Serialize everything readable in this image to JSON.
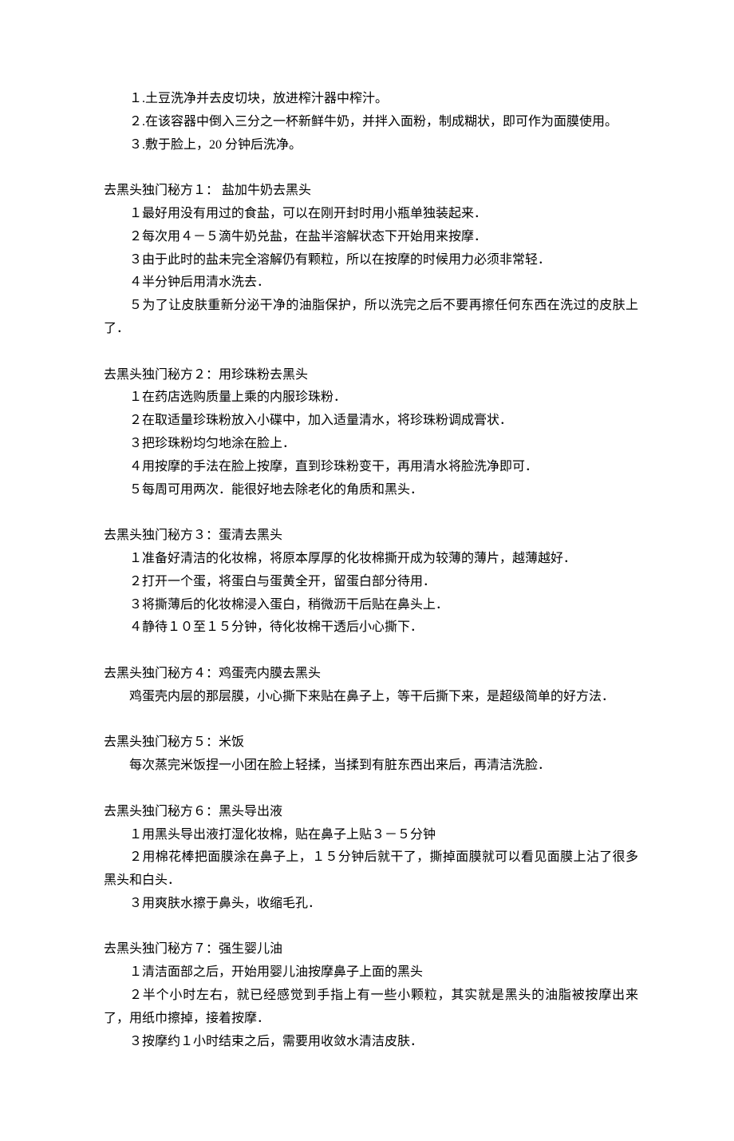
{
  "intro": [
    "１.土豆洗净并去皮切块，放进榨汁器中榨汁。",
    "２.在该容器中倒入三分之一杯新鲜牛奶，并拌入面粉，制成糊状，即可作为面膜使用。",
    "３.敷于脸上，20 分钟后洗净。"
  ],
  "sections": [
    {
      "title": "去黑头独门秘方１： 盐加牛奶去黑头",
      "lines": [
        "１最好用没有用过的食盐，可以在刚开封时用小瓶单独装起来．",
        "２每次用４－５滴牛奶兑盐，在盐半溶解状态下开始用来按摩．",
        "３由于此时的盐未完全溶解仍有颗粒，所以在按摩的时候用力必须非常轻．",
        "４半分钟后用清水洗去．",
        "５为了让皮肤重新分泌干净的油脂保护，所以洗完之后不要再擦任何东西在洗过的皮肤上了．"
      ],
      "hang": [
        4
      ]
    },
    {
      "title": "去黑头独门秘方２：用珍珠粉去黑头",
      "lines": [
        "１在药店选购质量上乘的内服珍珠粉．",
        "２在取适量珍珠粉放入小碟中，加入适量清水，将珍珠粉调成膏状．",
        "３把珍珠粉均匀地涂在脸上．",
        "４用按摩的手法在脸上按摩，直到珍珠粉变干，再用清水将脸洗净即可．",
        "５每周可用两次．能很好地去除老化的角质和黑头．"
      ]
    },
    {
      "title": "去黑头独门秘方３：蛋清去黑头",
      "lines": [
        "１准备好清洁的化妆棉，将原本厚厚的化妆棉撕开成为较薄的薄片，越薄越好．",
        "２打开一个蛋，将蛋白与蛋黄全开，留蛋白部分待用．",
        "３将撕薄后的化妆棉浸入蛋白，稍微沥干后贴在鼻头上．",
        "４静待１０至１５分钟，待化妆棉干透后小心撕下．"
      ]
    },
    {
      "title": "去黑头独门秘方４：鸡蛋壳内膜去黑头",
      "lines": [
        "鸡蛋壳内层的那层膜，小心撕下来贴在鼻子上，等干后撕下来，是超级简单的好方法．"
      ],
      "hang": [
        0
      ]
    },
    {
      "title": "去黑头独门秘方５：米饭",
      "lines": [
        "每次蒸完米饭捏一小团在脸上轻揉，当揉到有脏东西出来后，再清洁洗脸．"
      ]
    },
    {
      "title": "去黑头独门秘方６：黑头导出液",
      "lines": [
        "１用黑头导出液打湿化妆棉，贴在鼻子上贴３－５分钟",
        "２用棉花棒把面膜涂在鼻子上，１５分钟后就干了，撕掉面膜就可以看见面膜上沾了很多黑头和白头．",
        "３用爽肤水擦于鼻头，收缩毛孔．"
      ],
      "hang": [
        1
      ]
    },
    {
      "title": "去黑头独门秘方７：强生婴儿油",
      "lines": [
        "１清洁面部之后，开始用婴儿油按摩鼻子上面的黑头",
        "２半个小时左右，就已经感觉到手指上有一些小颗粒，其实就是黑头的油脂被按摩出来了，用纸巾擦掉，接着按摩．",
        "３按摩约１小时结束之后，需要用收敛水清洁皮肤．"
      ],
      "hang": [
        1
      ]
    }
  ]
}
